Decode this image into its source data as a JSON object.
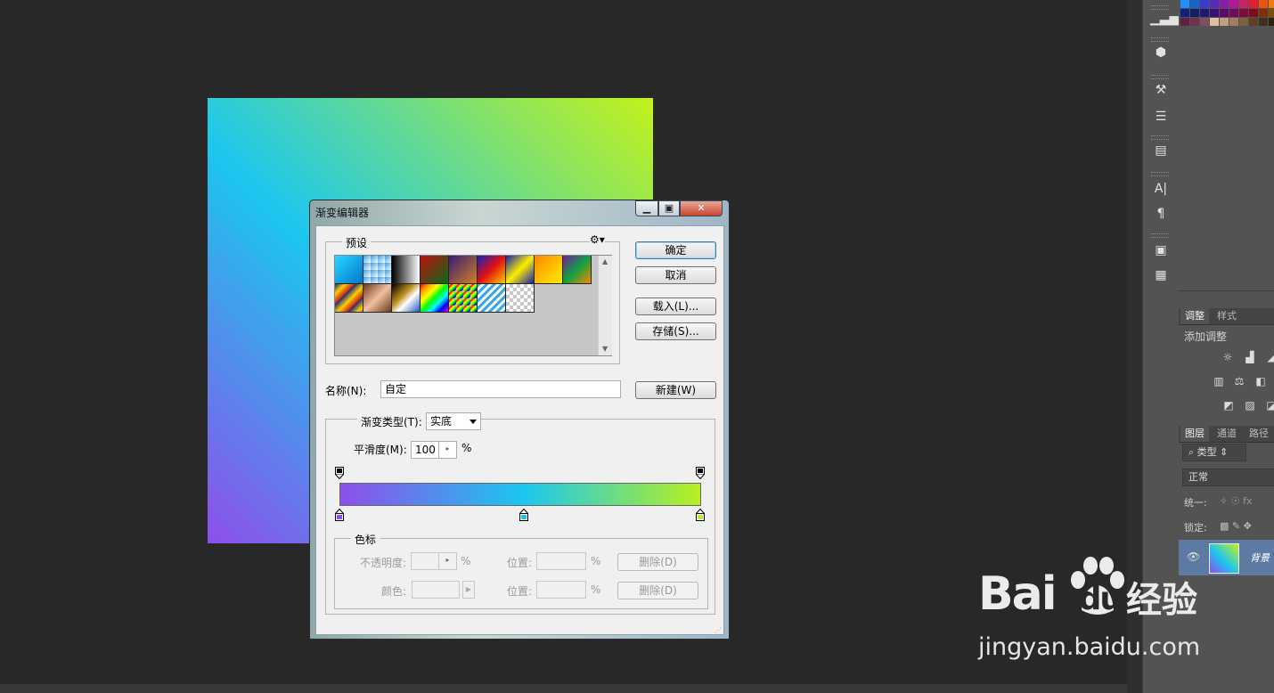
{
  "dialog": {
    "title": "渐变编辑器",
    "presets_label": "预设",
    "ok_label": "确定",
    "cancel_label": "取消",
    "load_label": "载入(L)...",
    "save_label": "存储(S)...",
    "name_label": "名称(N):",
    "name_value": "自定",
    "new_label": "新建(W)",
    "gradient_type_label": "渐变类型(T):",
    "gradient_type_value": "实底",
    "smoothness_label": "平滑度(M):",
    "smoothness_value": "100",
    "smoothness_unit": "%",
    "stops_label": "色标",
    "opacity_label": "不透明度:",
    "percent_unit": "%",
    "location_label": "位置:",
    "delete_label": "删除(D)",
    "color_label": "颜色:",
    "gradient_colors": [
      "#8e4fea",
      "#1bc7ef",
      "#b8f020"
    ],
    "color_stop_positions": [
      0,
      51,
      100
    ]
  },
  "panels": {
    "adjust_tab": "调整",
    "style_tab": "样式",
    "add_adjustment": "添加调整",
    "layers_tab": "图层",
    "channels_tab": "通道",
    "paths_tab": "路径",
    "kind_filter": "类型",
    "blend_mode": "正常",
    "unify_label": "统一:",
    "lock_label": "锁定:",
    "layer_name": "背景"
  },
  "watermark": {
    "brand": "Bai",
    "brand_suffix": "du",
    "product": "经验",
    "url": "jingyan.baidu.com"
  }
}
